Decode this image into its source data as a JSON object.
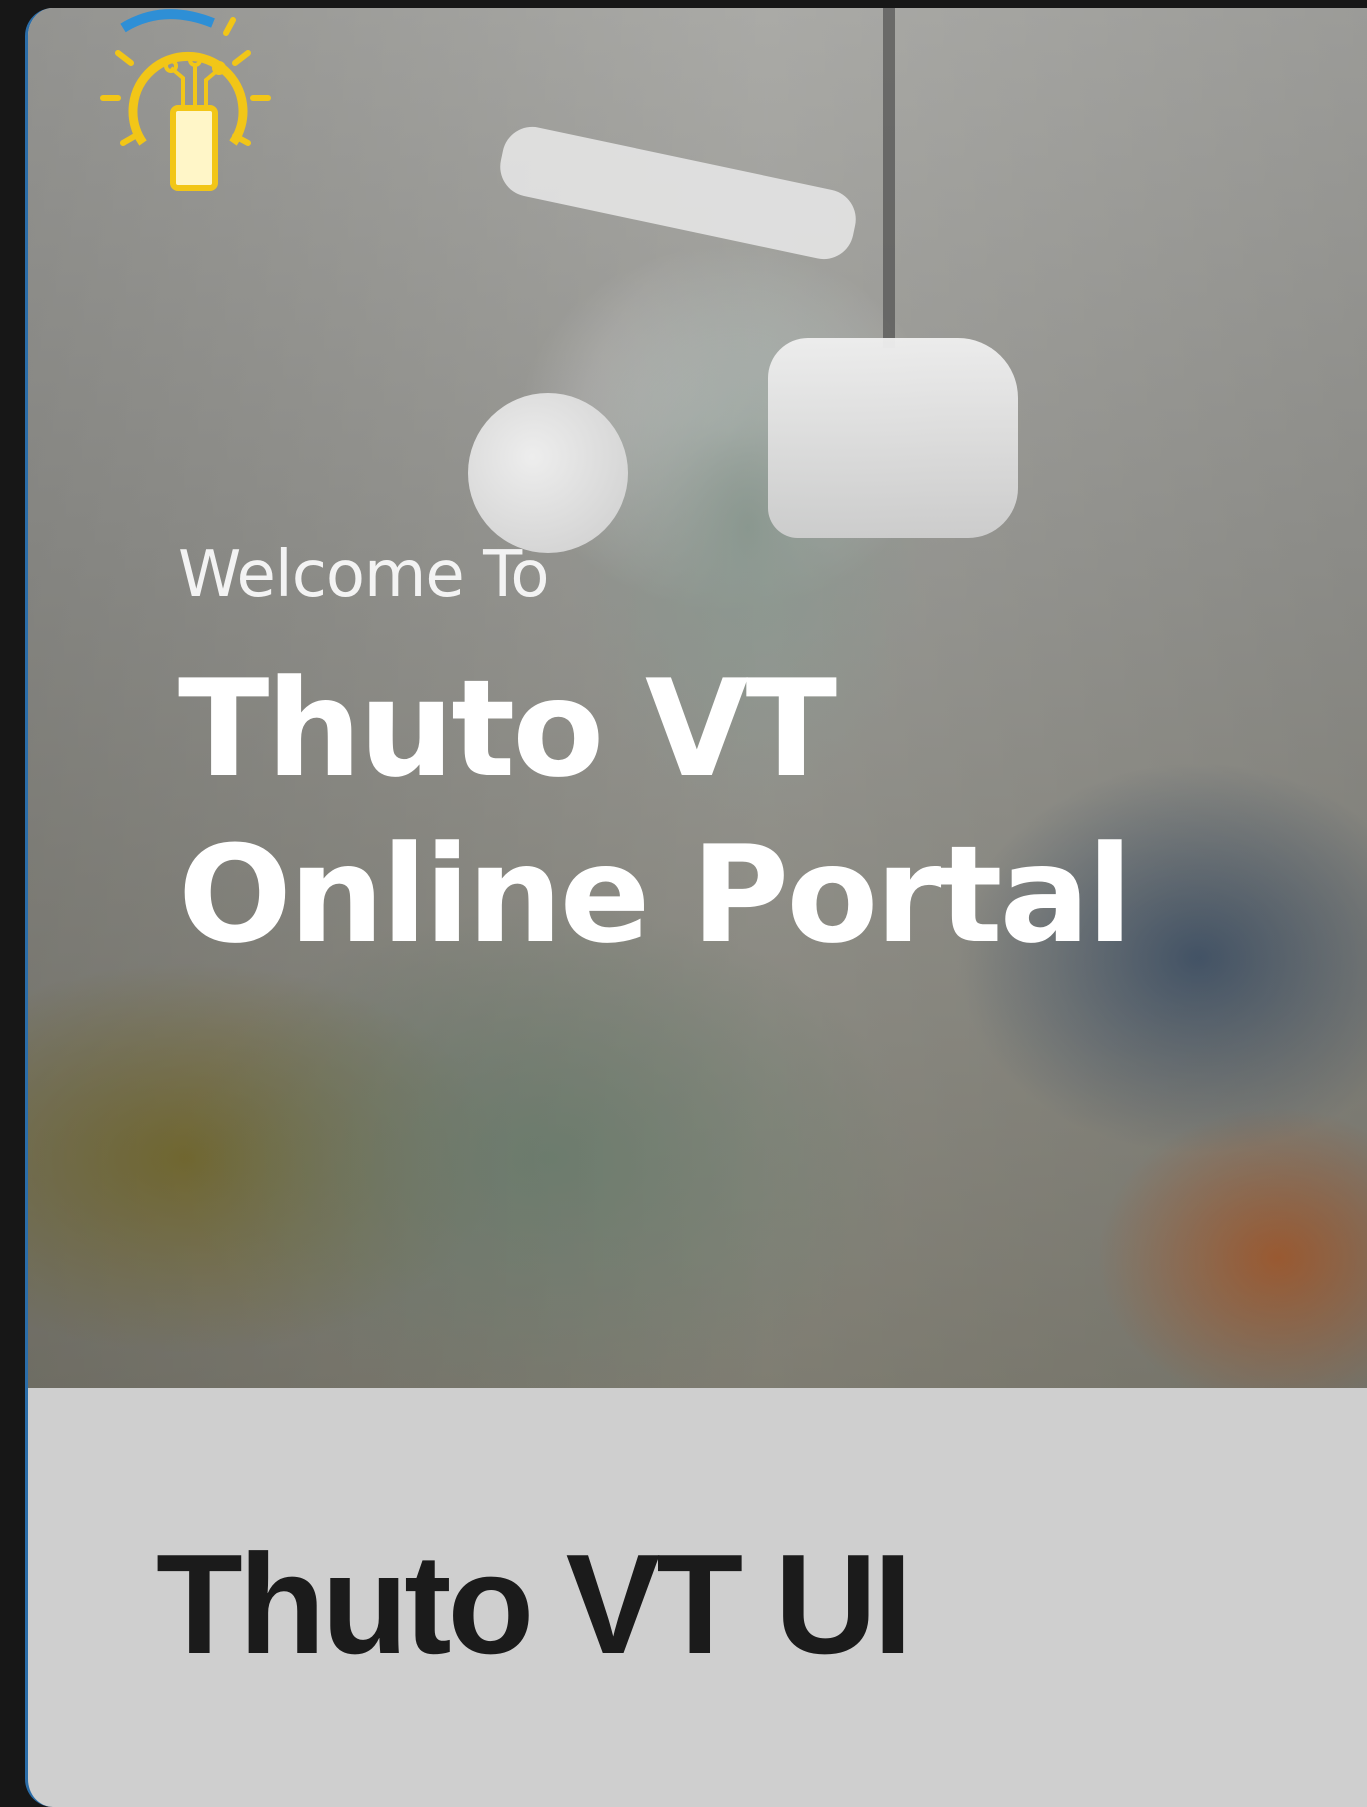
{
  "hero": {
    "welcome": "Welcome To",
    "title_line1": "Thuto VT",
    "title_line2": "Online Portal"
  },
  "card": {
    "caption": "Thuto VT UI"
  },
  "logo": {
    "icon": "lightbulb-circuit-phone-logo",
    "color": "#f2c617"
  }
}
